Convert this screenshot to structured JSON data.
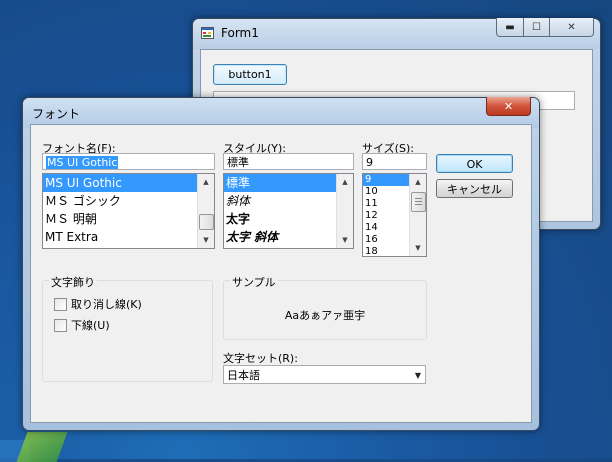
{
  "form1": {
    "title": "Form1",
    "controls": {
      "minimize": "▬",
      "maximize": "☐",
      "close": "✕"
    },
    "button_label": "button1",
    "textbox_value": ""
  },
  "font_dialog": {
    "title": "フォント",
    "close": "✕",
    "font_name": {
      "label": "フォント名(F):",
      "value": "MS UI Gothic",
      "items": [
        {
          "text": "MS UI Gothic",
          "selected": true
        },
        {
          "text": "ＭＳ ゴシック",
          "selected": false
        },
        {
          "text": "ＭＳ 明朝",
          "selected": false
        },
        {
          "text": "MT Extra",
          "selected": false
        }
      ]
    },
    "style": {
      "label": "スタイル(Y):",
      "value": "標準",
      "items": [
        {
          "text": "標準",
          "selected": true,
          "variant": "regular"
        },
        {
          "text": "斜体",
          "selected": false,
          "variant": "italic"
        },
        {
          "text": "太字",
          "selected": false,
          "variant": "bold"
        },
        {
          "text": "太字 斜体",
          "selected": false,
          "variant": "bold-italic"
        }
      ]
    },
    "size": {
      "label": "サイズ(S):",
      "value": "9",
      "items": [
        {
          "text": "9",
          "selected": true
        },
        {
          "text": "10",
          "selected": false
        },
        {
          "text": "11",
          "selected": false
        },
        {
          "text": "12",
          "selected": false
        },
        {
          "text": "14",
          "selected": false
        },
        {
          "text": "16",
          "selected": false
        },
        {
          "text": "18",
          "selected": false
        }
      ]
    },
    "ok_label": "OK",
    "cancel_label": "キャンセル",
    "effects": {
      "caption": "文字飾り",
      "strikeout_label": "取り消し線(K)",
      "underline_label": "下線(U)",
      "strikeout_checked": false,
      "underline_checked": false
    },
    "sample": {
      "caption": "サンプル",
      "text": "Aaあぁアァ亜宇"
    },
    "charset": {
      "label": "文字セット(R):",
      "value": "日本語"
    }
  },
  "colors": {
    "selection": "#3399ff",
    "close_red": "#c7442a",
    "dialog_face": "#f0f0f0"
  }
}
